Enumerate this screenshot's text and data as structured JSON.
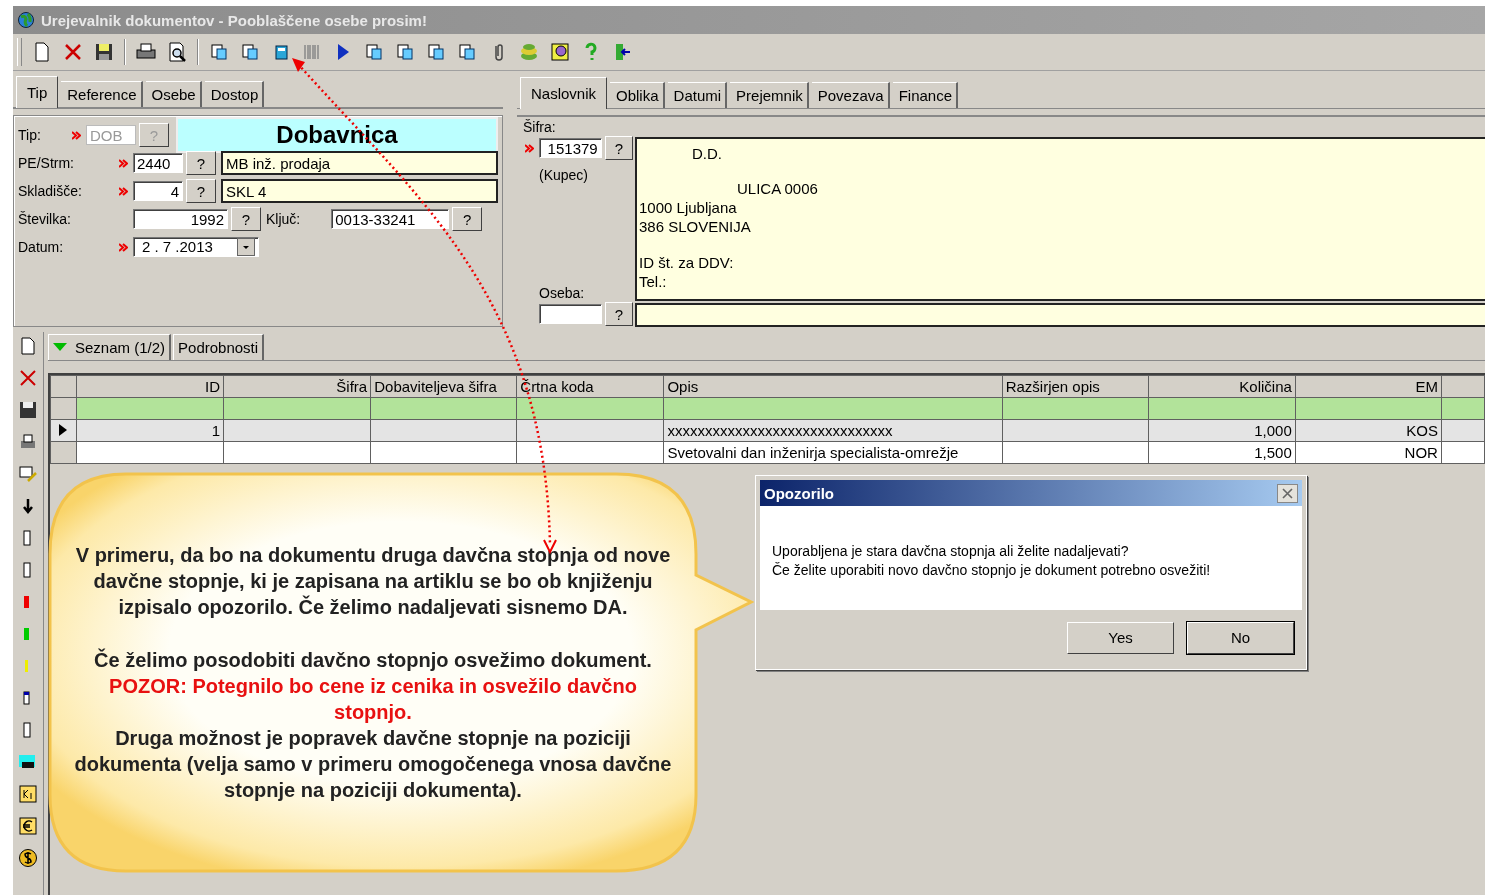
{
  "window": {
    "title": "Urejevalnik dokumentov - Pooblaščene osebe prosim!"
  },
  "left_tabs": [
    {
      "label": "Tip",
      "selected": true
    },
    {
      "label": "Reference",
      "selected": false
    },
    {
      "label": "Osebe",
      "selected": false
    },
    {
      "label": "Dostop",
      "selected": false
    }
  ],
  "right_tabs": [
    {
      "label": "Naslovnik",
      "selected": true
    },
    {
      "label": "Oblika",
      "selected": false
    },
    {
      "label": "Datumi",
      "selected": false
    },
    {
      "label": "Prejemnik",
      "selected": false
    },
    {
      "label": "Povezava",
      "selected": false
    },
    {
      "label": "Finance",
      "selected": false
    }
  ],
  "header": {
    "tip": {
      "label": "Tip:",
      "required": true,
      "code": "DOB",
      "button": "?",
      "disabled": true,
      "name": "Dobavnica"
    },
    "pe": {
      "label": "PE/Strm:",
      "required": true,
      "code": "2440",
      "button": "?",
      "name": "MB inž. prodaja"
    },
    "skladisce": {
      "label": "Skladišče:",
      "required": true,
      "code": "4",
      "button": "?",
      "name": "SKL 4"
    },
    "stevilka": {
      "label": "Številka:",
      "code": "1992",
      "button": "?"
    },
    "kljuc": {
      "label": "Ključ:",
      "value": "0013-33241",
      "button": "?"
    },
    "datum": {
      "label": "Datum:",
      "required": true,
      "value": "2 . 7 .2013"
    }
  },
  "recipient": {
    "sifra_label": "Šifra:",
    "required": true,
    "sifra": "151379",
    "button": "?",
    "role": "(Kupec)",
    "address": [
      "D.D.",
      "ULICA 0006",
      "1000 Ljubljana",
      "386 SLOVENIJA",
      "ID št. za DDV:",
      "Tel.:"
    ],
    "oseba_label": "Oseba:",
    "oseba_button": "?"
  },
  "item_tabs": [
    {
      "label": "Seznam (1/2)",
      "selected": true
    },
    {
      "label": "Podrobnosti",
      "selected": false
    }
  ],
  "table": {
    "columns": [
      "ID",
      "Šifra",
      "Dobaviteljeva šifra",
      "Črtna koda",
      "Opis",
      "Razširjen opis",
      "Količina",
      "EM"
    ],
    "rows": [
      {
        "new": true,
        "current": false,
        "cells": [
          "",
          "",
          "",
          "",
          "",
          "",
          "",
          ""
        ]
      },
      {
        "new": false,
        "current": true,
        "cells": [
          "1",
          "",
          "",
          "",
          "xxxxxxxxxxxxxxxxxxxxxxxxxxxxxx",
          "",
          "1,000",
          "KOS"
        ]
      },
      {
        "new": false,
        "current": false,
        "cells": [
          "",
          "",
          "",
          "",
          "Svetovalni dan inženirja specialista-omrežje",
          "",
          "1,500",
          "NOR"
        ]
      }
    ]
  },
  "dialog": {
    "title": "Opozorilo",
    "message": [
      "Uporabljena je stara davčna stopnja ali želite nadaljevati?",
      "Če želite uporabiti novo davčno stopnjo je dokument potrebno osvežiti!"
    ],
    "buttons": [
      {
        "label": "Yes",
        "default": false
      },
      {
        "label": "No",
        "default": true
      }
    ]
  },
  "callout": {
    "paragraphs": [
      {
        "kind": "normal",
        "text": "V primeru, da bo na dokumentu druga davčna stopnja od nove davčne stopnje, ki je zapisana na artiklu se bo ob knjiženju izpisalo opozorilo. Če želimo nadaljevati sisnemo DA."
      },
      {
        "kind": "spacer_normal",
        "text": "Če želimo posodobiti davčno stopnjo osvežimo dokument."
      },
      {
        "kind": "warning",
        "text": "POZOR: Potegnilo bo cene iz cenika in osvežilo davčno stopnjo."
      },
      {
        "kind": "normal",
        "text": "Druga možnost je popravek davčne stopnje na poziciji dokumenta (velja samo v primeru omogočenega vnosa davčne stopnje na poziciji dokumenta)."
      }
    ]
  }
}
